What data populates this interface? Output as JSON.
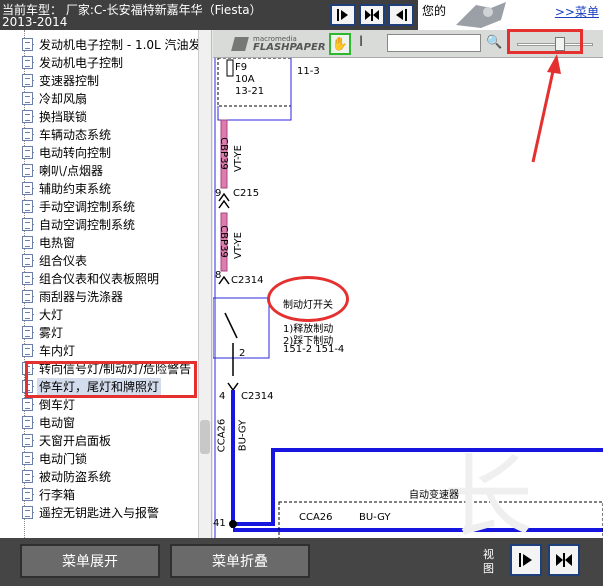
{
  "header": {
    "current_car_line1": "当前车型： 厂家:C-长安福特新嘉年华（Fiesta）",
    "current_car_line2": "2013-2014",
    "welcome": "您的",
    "menu_link": ">>菜单"
  },
  "sidebar": {
    "items": [
      {
        "label": "发动机电子控制 - 1.0L 汽油发"
      },
      {
        "label": "发动机电子控制"
      },
      {
        "label": "变速器控制"
      },
      {
        "label": "冷却风扇"
      },
      {
        "label": "换挡联锁"
      },
      {
        "label": "车辆动态系统"
      },
      {
        "label": "电动转向控制"
      },
      {
        "label": "喇叭/点烟器"
      },
      {
        "label": "辅助约束系统"
      },
      {
        "label": "手动空调控制系统"
      },
      {
        "label": "自动空调控制系统"
      },
      {
        "label": "电热窗"
      },
      {
        "label": "组合仪表"
      },
      {
        "label": "组合仪表和仪表板照明"
      },
      {
        "label": "雨刮器与洗涤器"
      },
      {
        "label": "大灯"
      },
      {
        "label": "雾灯"
      },
      {
        "label": "车内灯"
      },
      {
        "label": "转向信号灯/制动灯/危险警告"
      },
      {
        "label": "停车灯，尾灯和牌照灯",
        "selected": true
      },
      {
        "label": "倒车灯"
      },
      {
        "label": "电动窗"
      },
      {
        "label": "天窗开启面板"
      },
      {
        "label": "电动门锁"
      },
      {
        "label": "被动防盗系统"
      },
      {
        "label": "行李箱"
      },
      {
        "label": "遥控无钥匙进入与报警"
      }
    ]
  },
  "flash_toolbar": {
    "logo_top": "macromedia",
    "logo_bottom": "FLASHPAPER",
    "hand_icon": "hand-icon",
    "text_select_icon": "text-cursor-icon",
    "search_icon": "magnifier-icon"
  },
  "diagram": {
    "fuse_name": "F9",
    "fuse_rating": "10A",
    "fuse_ref": "13-21",
    "ref_11_3": "11-3",
    "wire_1": "CBP39",
    "wire_1_color": "VT-YE",
    "pin_9": "9",
    "conn_c215": "C215",
    "wire_2": "CBP39",
    "wire_2_color": "VT-YE",
    "pin_8": "8",
    "conn_c2314_a": "C2314",
    "switch_title": "制动灯开关",
    "switch_note_1": "1)释放制动",
    "switch_note_2": "2)踩下制动",
    "switch_refs": "151-2 151-4",
    "pin_2": "2",
    "pin_4": "4",
    "conn_c2314_b": "C2314",
    "wire_3": "CCA26",
    "wire_3_color": "BU-GY",
    "module_label": "自动变速器",
    "bus_wire": "CCA26",
    "bus_color": "BU-GY",
    "pin_41": "41"
  },
  "bottom": {
    "expand_label": "菜单展开",
    "collapse_label": "菜单折叠",
    "view_label": "视图"
  },
  "colors": {
    "annotation_red": "#e53030",
    "wire_blue": "#1616e0",
    "wire_pink": "#e07bb0",
    "header_bg": "#3f3f3f",
    "selected_bg": "#d3dcec"
  }
}
